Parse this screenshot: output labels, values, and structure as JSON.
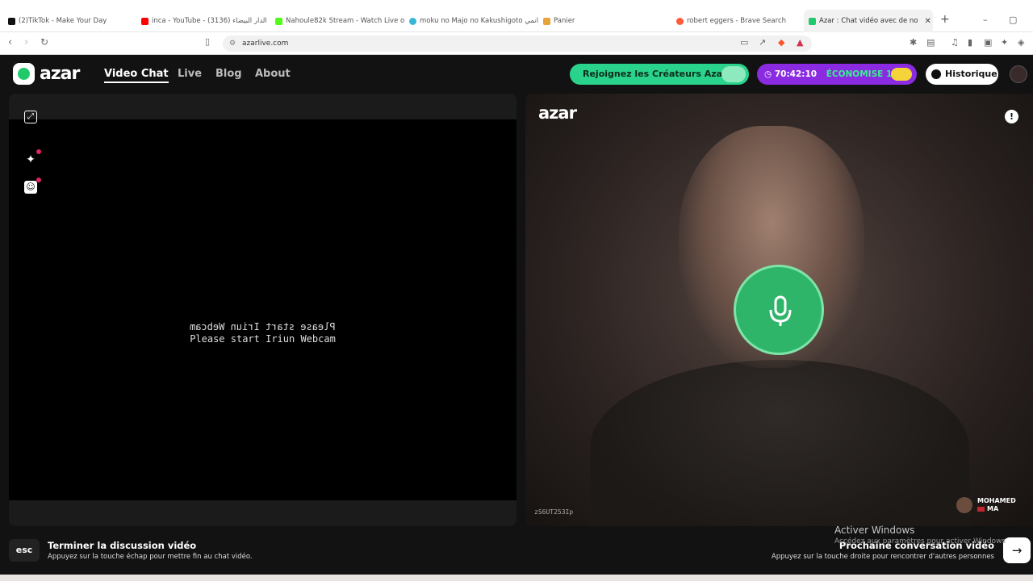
{
  "browser": {
    "tabs": [
      {
        "label": "(2)TikTok - Make Your Day",
        "color": "#111111"
      },
      {
        "label": "inca - YouTube - الدار البيضاء (3136)",
        "color": "#ff0000"
      },
      {
        "label": "Nahoule82k Stream - Watch Live on",
        "color": "#53fc18"
      },
      {
        "label": "moku no Majo no Kakushigoto انمي",
        "color": "#38b6d8"
      },
      {
        "label": "Panier",
        "color": "#e8a23a"
      },
      {
        "label": "robert eggers - Brave Search",
        "color": "#ff5b36"
      },
      {
        "label": "Azar : Chat vidéo avec de no",
        "color": "#20c96a"
      }
    ],
    "url": "azarlive.com"
  },
  "header": {
    "logo": "azar",
    "nav": [
      "Video Chat",
      "Live",
      "Blog",
      "About"
    ],
    "creators_label": "Rejoignez les Créateurs Azar",
    "timer": "70:42:10",
    "savings": "ÉCONOMISE 15%",
    "history_label": "Historique"
  },
  "left_panel": {
    "webcam_line1": "Please start Iriun Webcam",
    "webcam_line2": "Please start Iriun Webcam"
  },
  "right_panel": {
    "logo": "azar",
    "user_id": "zS6UT253Ip",
    "peer_name": "MOHAMED",
    "peer_country": "MA"
  },
  "bottom": {
    "esc_label": "esc",
    "end_title": "Terminer la discussion vidéo",
    "end_subtitle": "Appuyez sur la touche échap pour mettre fin au chat vidéo.",
    "next_title": "Prochaine conversation vidéo",
    "next_subtitle": "Appuyez sur la touche droite pour rencontrer d'autres personnes"
  },
  "windows_watermark": {
    "title": "Activer Windows",
    "subtitle": "Accédez aux paramètres pour activer Windows"
  }
}
